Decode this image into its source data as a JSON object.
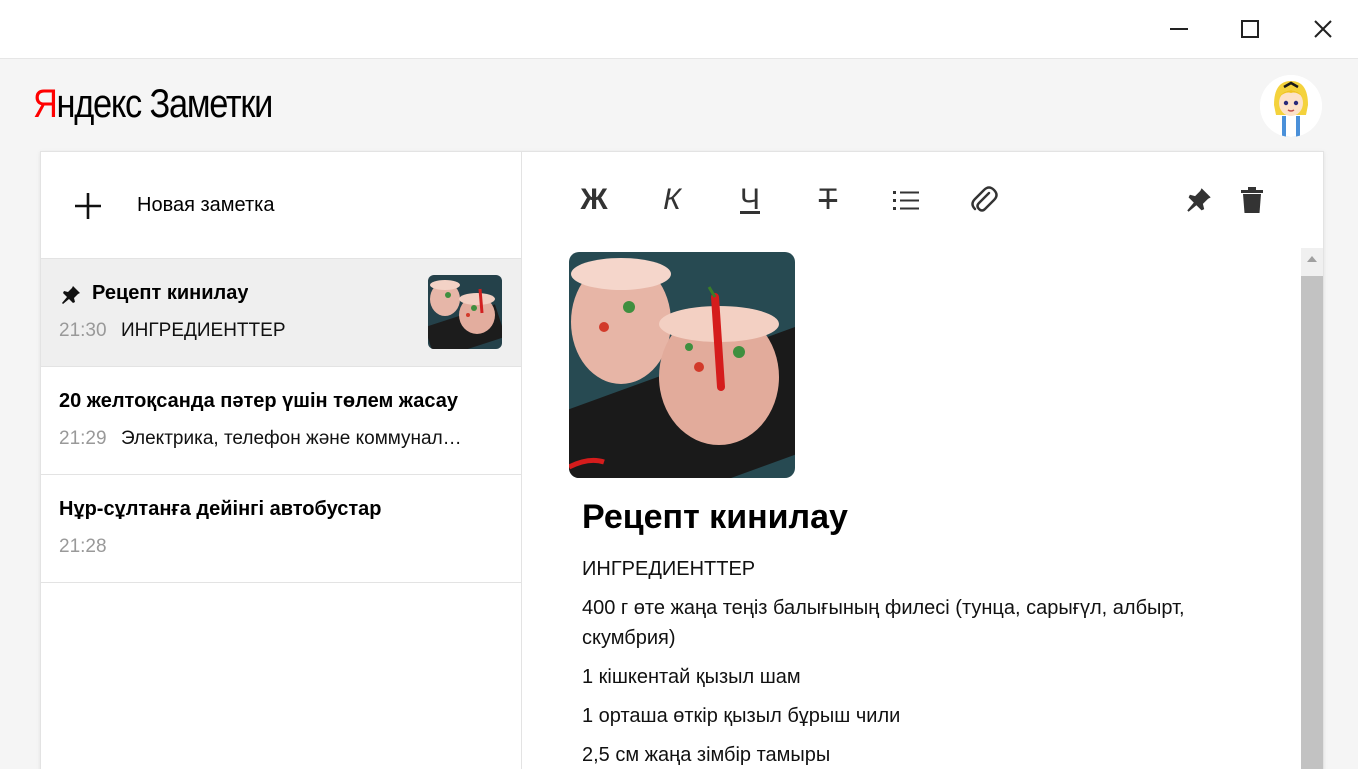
{
  "app": {
    "logo_brand_first": "Я",
    "logo_brand_rest": "ндекс",
    "logo_product": "Заметки"
  },
  "window_controls": {
    "minimize_icon": "minimize-icon",
    "maximize_icon": "maximize-icon",
    "close_icon": "close-icon"
  },
  "sidebar": {
    "new_note_label": "Новая заметка",
    "notes": [
      {
        "title": "Рецепт кинилау",
        "time": "21:30",
        "snippet": "ИНГРЕДИЕНТТЕР",
        "pinned": true,
        "has_thumbnail": true
      },
      {
        "title": "20 желтоқсанда пәтер үшін төлем жасау",
        "time": "21:29",
        "snippet": "Электрика, телефон және коммунал…",
        "pinned": false,
        "has_thumbnail": false
      },
      {
        "title": "Нұр-сұлтанға дейінгі автобустар",
        "time": "21:28",
        "snippet": "",
        "pinned": false,
        "has_thumbnail": false
      }
    ]
  },
  "toolbar": {
    "bold": "Ж",
    "italic": "К",
    "underline": "Ч",
    "strikethrough": "Т",
    "list_icon": "list-icon",
    "attach_icon": "paperclip-icon",
    "pin_icon": "pin-icon",
    "delete_icon": "trash-icon"
  },
  "editor": {
    "title": "Рецепт кинилау",
    "lines": [
      "ИНГРЕДИЕНТТЕР",
      "400 г өте жаңа теңіз балығының филесі (тунца, сарығүл, албырт, скумбрия)",
      "1 кішкентай қызыл шам",
      "1 орташа өткір қызыл бұрыш чили",
      "2,5 см жаңа зімбір тамыры"
    ]
  },
  "colors": {
    "brand_red": "#ff0000",
    "active_note_bg": "#efefef",
    "page_bg": "#f5f5f5"
  }
}
